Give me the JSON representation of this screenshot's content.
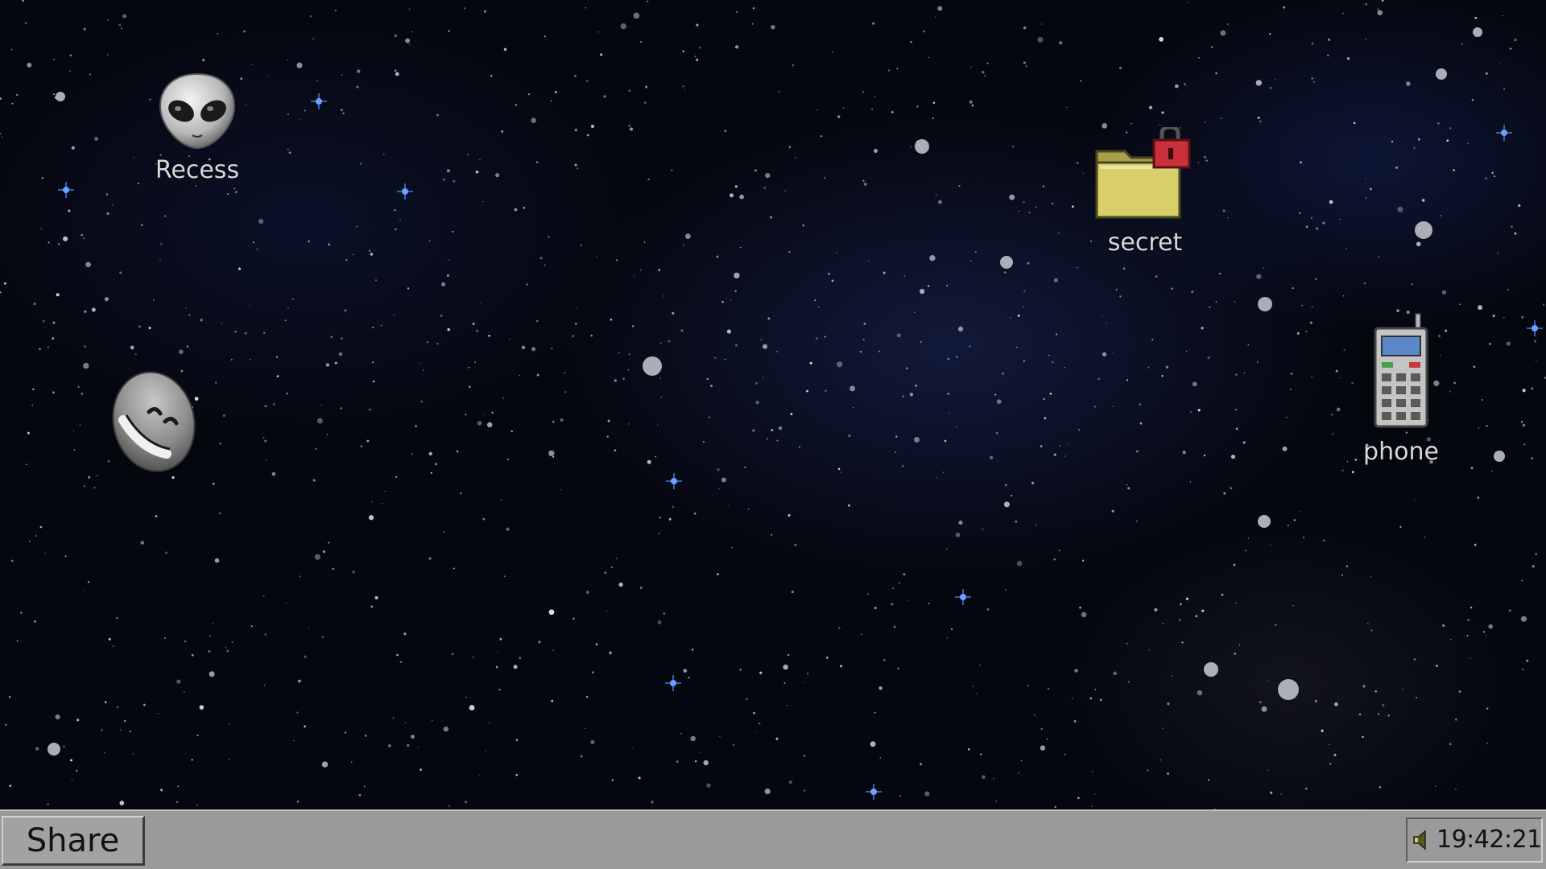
{
  "desktop": {
    "wallpaper": "starfield",
    "icons": [
      {
        "name": "alien-icon",
        "label": "Recess"
      },
      {
        "name": "locked-folder-icon",
        "label": "secret"
      },
      {
        "name": "phone-icon",
        "label": "phone"
      },
      {
        "name": "satellite-dish-icon",
        "label": ""
      }
    ]
  },
  "taskbar": {
    "start_label": "Share",
    "clock": "19:42:21",
    "tray_icon": "speaker-icon"
  },
  "colors": {
    "taskbar_bg": "#9a9a9a",
    "desktop_bg": "#05070f",
    "label_text": "#d8d8d8",
    "lock_red": "#c8303a",
    "folder_yellow": "#d8cf6a"
  }
}
